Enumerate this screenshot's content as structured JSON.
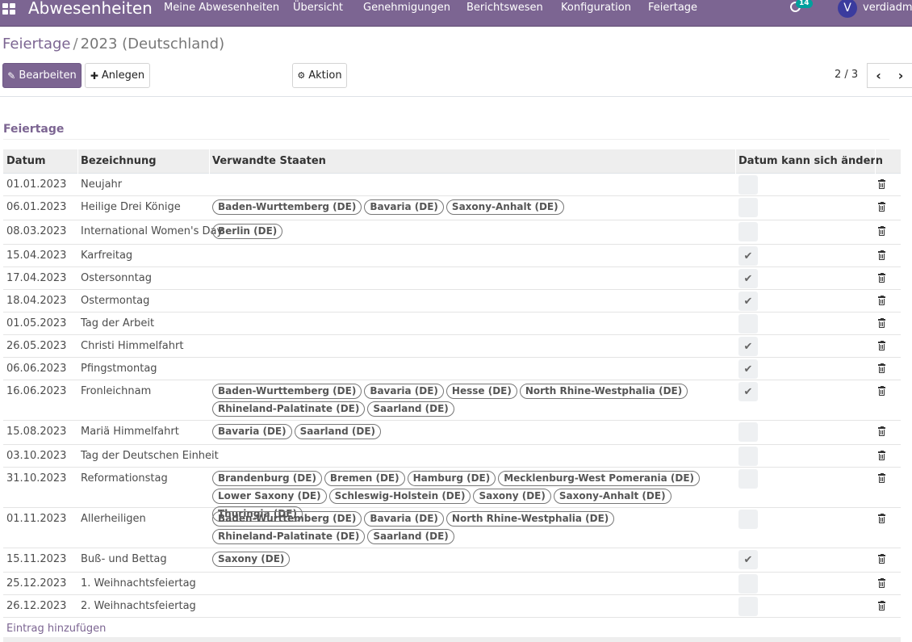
{
  "navbar": {
    "app_title": "Abwesenheiten",
    "menu": [
      "Meine Abwesenheiten",
      "Übersicht",
      "Genehmigungen",
      "Berichtswesen",
      "Konfiguration",
      "Feiertage"
    ],
    "activity_count": "14",
    "avatar_initial": "V",
    "user_name": "verdiadmin"
  },
  "breadcrumb": {
    "parent": "Feiertage",
    "separator": "/",
    "current": "2023 (Deutschland)"
  },
  "buttons": {
    "edit": "Bearbeiten",
    "create": "Anlegen",
    "action": "Aktion"
  },
  "pager": {
    "value": "2 / 3"
  },
  "section": {
    "title": "Feiertage"
  },
  "table": {
    "headers": [
      "Datum",
      "Bezeichnung",
      "Verwandte Staaten",
      "Datum kann sich ändern"
    ],
    "rows": [
      {
        "date": "01.01.2023",
        "name": "Neujahr",
        "states": [],
        "variable": false
      },
      {
        "date": "06.01.2023",
        "name": "Heilige Drei Könige",
        "states": [
          "Baden-Wurttemberg (DE)",
          "Bavaria (DE)",
          "Saxony-Anhalt (DE)"
        ],
        "variable": false
      },
      {
        "date": "08.03.2023",
        "name": "International Women's Day",
        "states": [
          "Berlin (DE)"
        ],
        "variable": false
      },
      {
        "date": "15.04.2023",
        "name": "Karfreitag",
        "states": [],
        "variable": true
      },
      {
        "date": "17.04.2023",
        "name": "Ostersonntag",
        "states": [],
        "variable": true
      },
      {
        "date": "18.04.2023",
        "name": "Ostermontag",
        "states": [],
        "variable": true
      },
      {
        "date": "01.05.2023",
        "name": "Tag der Arbeit",
        "states": [],
        "variable": false
      },
      {
        "date": "26.05.2023",
        "name": "Christi Himmelfahrt",
        "states": [],
        "variable": true
      },
      {
        "date": "06.06.2023",
        "name": "Pfingstmontag",
        "states": [],
        "variable": true
      },
      {
        "date": "16.06.2023",
        "name": "Fronleichnam",
        "states": [
          "Baden-Wurttemberg (DE)",
          "Bavaria (DE)",
          "Hesse (DE)",
          "North Rhine-Westphalia (DE)",
          "Rhineland-Palatinate (DE)",
          "Saarland (DE)"
        ],
        "variable": true
      },
      {
        "date": "15.08.2023",
        "name": "Mariä Himmelfahrt",
        "states": [
          "Bavaria (DE)",
          "Saarland (DE)"
        ],
        "variable": false
      },
      {
        "date": "03.10.2023",
        "name": "Tag der Deutschen Einheit",
        "states": [],
        "variable": false
      },
      {
        "date": "31.10.2023",
        "name": "Reformationstag",
        "states": [
          "Brandenburg (DE)",
          "Bremen (DE)",
          "Hamburg (DE)",
          "Mecklenburg-West Pomerania (DE)",
          "Lower Saxony (DE)",
          "Schleswig-Holstein (DE)",
          "Saxony (DE)",
          "Saxony-Anhalt (DE)",
          "Thuringia (DE)"
        ],
        "variable": false
      },
      {
        "date": "01.11.2023",
        "name": "Allerheiligen",
        "states": [
          "Baden-Wurttemberg (DE)",
          "Bavaria (DE)",
          "North Rhine-Westphalia (DE)",
          "Rhineland-Palatinate (DE)",
          "Saarland (DE)"
        ],
        "variable": false
      },
      {
        "date": "15.11.2023",
        "name": "Buß- und Bettag",
        "states": [
          "Saxony (DE)"
        ],
        "variable": true
      },
      {
        "date": "25.12.2023",
        "name": "1. Weihnachtsfeiertag",
        "states": [],
        "variable": false
      },
      {
        "date": "26.12.2023",
        "name": "2. Weihnachtsfeiertag",
        "states": [],
        "variable": false
      }
    ],
    "add_line": "Eintrag hinzufügen"
  },
  "colors": {
    "brand": "#7c6592",
    "badge": "#00a09d"
  },
  "icons": [
    "apps-icon",
    "activity-icon",
    "pencil-icon",
    "plus-icon",
    "gear-icon",
    "chevron-left-icon",
    "chevron-right-icon",
    "checkmark-icon",
    "trash-icon"
  ]
}
